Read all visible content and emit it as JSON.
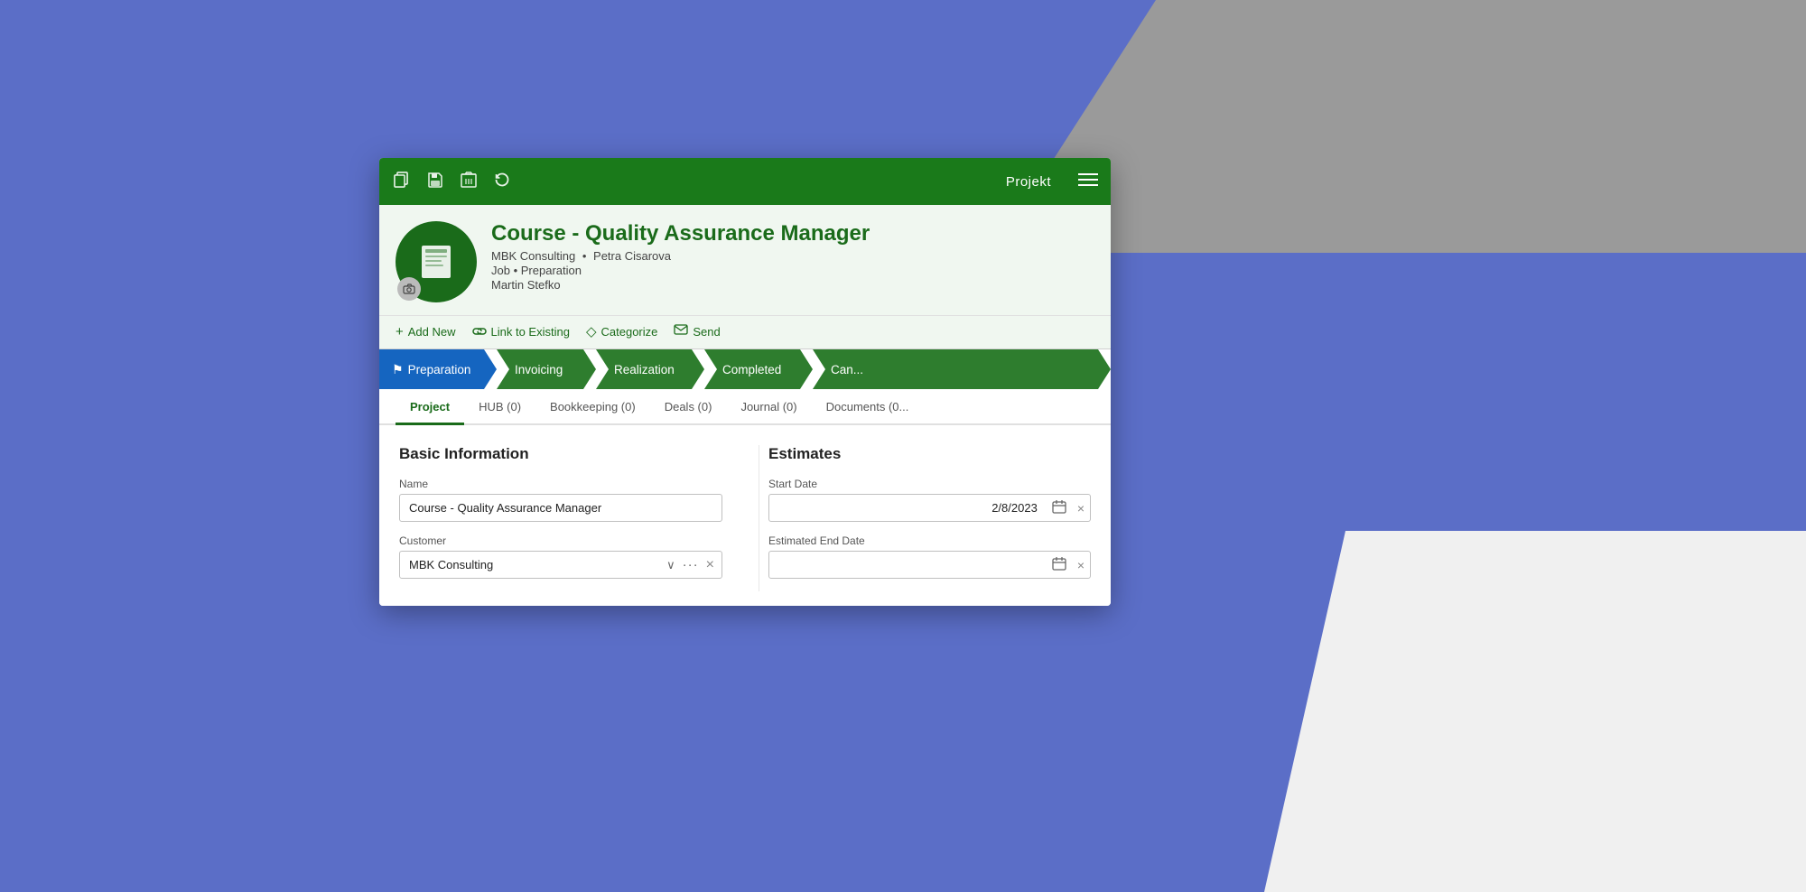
{
  "background": {
    "color": "#5b6ec7"
  },
  "toolbar": {
    "title": "Projekt",
    "save_icon": "💾",
    "copy_icon": "📋",
    "delete_icon": "🗑",
    "refresh_icon": "↺",
    "menu_icon": "≡"
  },
  "header": {
    "title": "Course - Quality Assurance Manager",
    "company": "MBK Consulting",
    "contact": "Petra Cisarova",
    "job_label": "Job",
    "stage_label": "Preparation",
    "manager": "Martin Stefko"
  },
  "actions": {
    "add_new": "Add New",
    "link_to_existing": "Link to Existing",
    "categorize": "Categorize",
    "send": "Send"
  },
  "stages": [
    {
      "label": "Preparation",
      "state": "active"
    },
    {
      "label": "Invoicing",
      "state": "done"
    },
    {
      "label": "Realization",
      "state": "done"
    },
    {
      "label": "Completed",
      "state": "done"
    },
    {
      "label": "Can...",
      "state": "done"
    }
  ],
  "tabs": [
    {
      "label": "Project",
      "active": true
    },
    {
      "label": "HUB (0)",
      "active": false
    },
    {
      "label": "Bookkeeping (0)",
      "active": false
    },
    {
      "label": "Deals (0)",
      "active": false
    },
    {
      "label": "Journal (0)",
      "active": false
    },
    {
      "label": "Documents (0...",
      "active": false
    }
  ],
  "basic_info": {
    "section_title": "Basic Information",
    "name_label": "Name",
    "name_value": "Course - Quality Assurance Manager",
    "customer_label": "Customer",
    "customer_value": "MBK Consulting"
  },
  "estimates": {
    "section_title": "Estimates",
    "start_date_label": "Start Date",
    "start_date_value": "2/8/2023",
    "end_date_label": "Estimated End Date",
    "end_date_value": ""
  }
}
